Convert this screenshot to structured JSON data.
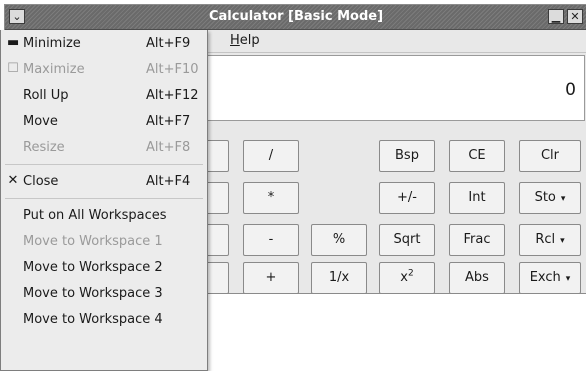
{
  "window": {
    "title": "Calculator  [Basic Mode]",
    "buttons": {
      "menu": "⌄",
      "minimize": "▁",
      "close": "✕"
    }
  },
  "menubar": {
    "help": "Help"
  },
  "display": {
    "value": "0"
  },
  "keypad": {
    "divide": "/",
    "multiply": "*",
    "minus": "-",
    "plus": "+",
    "percent": "%",
    "reciprocal": "1/x",
    "bsp": "Bsp",
    "ce": "CE",
    "clr": "Clr",
    "plusminus": "+/-",
    "int": "Int",
    "sto": "Sto",
    "sqrt": "Sqrt",
    "frac": "Frac",
    "rcl": "Rcl",
    "x2_base": "x",
    "x2_exp": "2",
    "abs": "Abs",
    "exch": "Exch",
    "dropdown_glyph": "▾"
  },
  "window_menu": {
    "minimize": {
      "label": "Minimize",
      "accel": "Alt+F9",
      "icon": "▬"
    },
    "maximize": {
      "label": "Maximize",
      "accel": "Alt+F10",
      "icon": "☐"
    },
    "rollup": {
      "label": "Roll Up",
      "accel": "Alt+F12"
    },
    "move": {
      "label": "Move",
      "accel": "Alt+F7"
    },
    "resize": {
      "label": "Resize",
      "accel": "Alt+F8"
    },
    "close": {
      "label": "Close",
      "accel": "Alt+F4",
      "icon": "✕"
    },
    "all_workspaces": "Put on All Workspaces",
    "ws1": "Move to Workspace 1",
    "ws2": "Move to Workspace 2",
    "ws3": "Move to Workspace 3",
    "ws4": "Move to Workspace 4"
  }
}
